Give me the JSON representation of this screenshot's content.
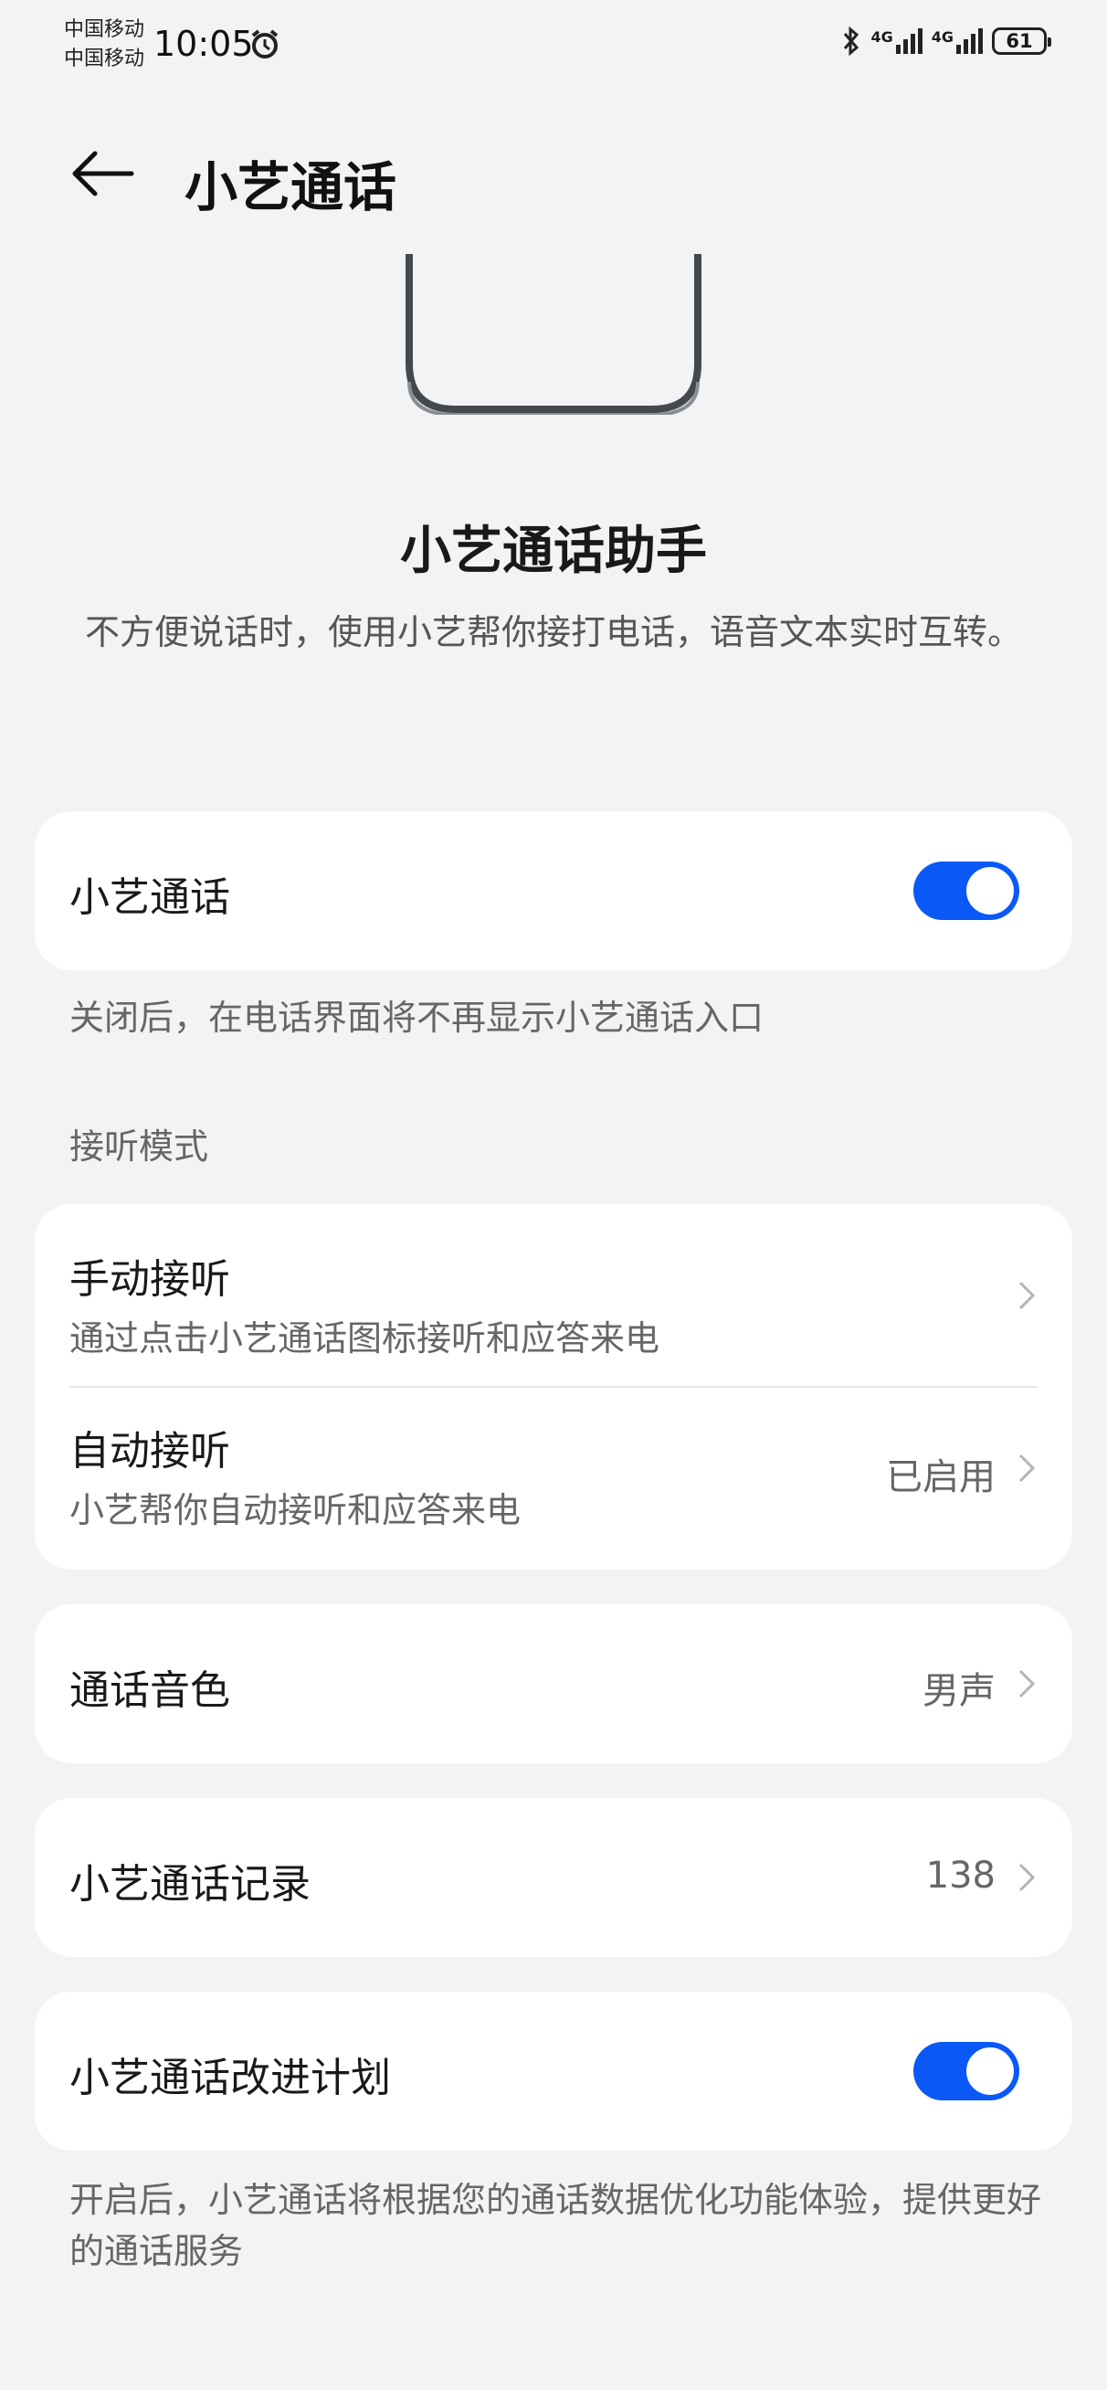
{
  "status_bar": {
    "carrier_1": "中国移动",
    "carrier_2": "中国移动",
    "time": "10:05",
    "battery": "61",
    "network_1": "4G",
    "network_2": "4G",
    "icons": [
      "alarm-icon",
      "bluetooth-icon",
      "signal-icon",
      "signal-icon",
      "battery-icon"
    ]
  },
  "header": {
    "title": "小艺通话",
    "back_icon": "back-arrow-icon"
  },
  "hero": {
    "title": "小艺通话助手",
    "description": "不方便说话时，使用小艺帮你接打电话，语音文本实时互转。"
  },
  "main_toggle": {
    "label": "小艺通话",
    "on": true,
    "note": "关闭后，在电话界面将不再显示小艺通话入口"
  },
  "answer_mode": {
    "section_label": "接听模式",
    "items": [
      {
        "title": "手动接听",
        "subtitle": "通过点击小艺通话图标接听和应答来电",
        "value": ""
      },
      {
        "title": "自动接听",
        "subtitle": "小艺帮你自动接听和应答来电",
        "value": "已启用"
      }
    ]
  },
  "voice": {
    "title": "通话音色",
    "value": "男声"
  },
  "records": {
    "title": "小艺通话记录",
    "value": "138"
  },
  "improvement": {
    "label": "小艺通话改进计划",
    "on": true,
    "note": "开启后，小艺通话将根据您的通话数据优化功能体验，提供更好的通话服务"
  },
  "colors": {
    "accent": "#0a59f7",
    "background": "#f1f3f5",
    "card": "#ffffff"
  }
}
